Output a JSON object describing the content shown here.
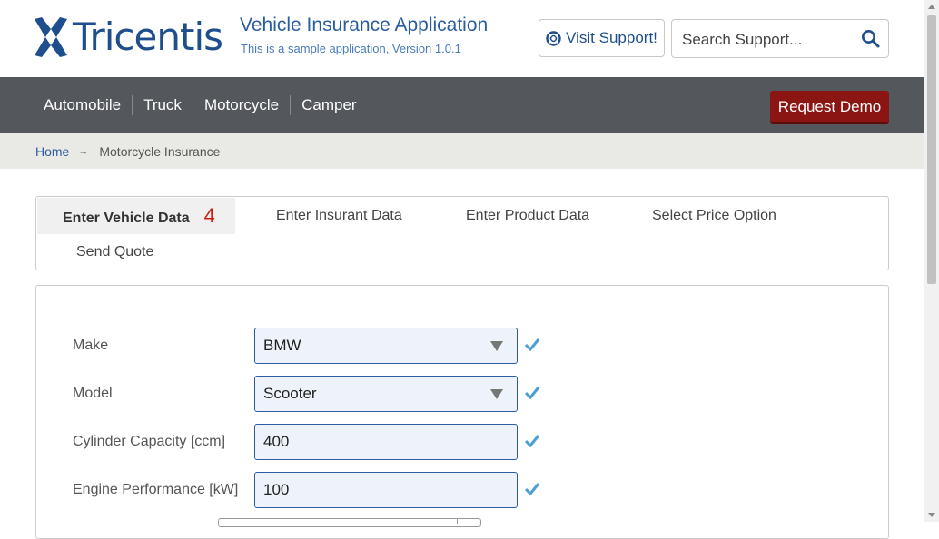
{
  "header": {
    "logo_text": "Tricentis",
    "app_title": "Vehicle Insurance Application",
    "app_subtitle": "This is a sample application, Version 1.0.1",
    "support_button": "Visit Support!",
    "search_placeholder": "Search Support..."
  },
  "nav": {
    "items": [
      "Automobile",
      "Truck",
      "Motorcycle",
      "Camper"
    ],
    "demo_button": "Request Demo"
  },
  "breadcrumb": {
    "home": "Home",
    "current": "Motorcycle Insurance"
  },
  "tabs": {
    "items": [
      {
        "label": "Enter Vehicle Data",
        "count": "4",
        "active": true
      },
      {
        "label": "Enter Insurant Data"
      },
      {
        "label": "Enter Product Data"
      },
      {
        "label": "Select Price Option"
      },
      {
        "label": "Send Quote"
      }
    ]
  },
  "form": {
    "make": {
      "label": "Make",
      "value": "BMW"
    },
    "model": {
      "label": "Model",
      "value": "Scooter"
    },
    "cylinder": {
      "label": "Cylinder Capacity [ccm]",
      "value": "400"
    },
    "engine": {
      "label": "Engine Performance [kW]",
      "value": "100"
    }
  },
  "colors": {
    "brand": "#1f4e8c",
    "nav_bg": "#54575b",
    "demo_button": "#8b1512",
    "field_bg": "#eef3fb",
    "check": "#4a9fd4",
    "count_red": "#cc1e12"
  },
  "icons": [
    "tricentis-logo-icon",
    "lifebuoy-icon",
    "search-icon",
    "chevron-down-icon",
    "checkmark-icon",
    "arrow-right-icon"
  ]
}
